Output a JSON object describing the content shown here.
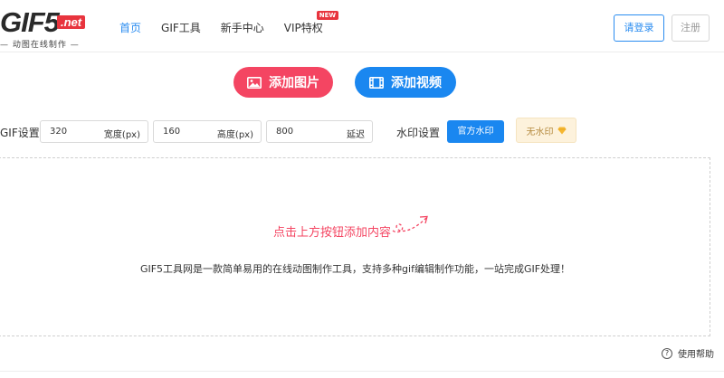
{
  "logo": {
    "main": "GIF5",
    "net": ".net",
    "tagline": "— 动图在线制作 —"
  },
  "nav": {
    "items": [
      {
        "label": "首页",
        "active": true
      },
      {
        "label": "GIF工具",
        "active": false
      },
      {
        "label": "新手中心",
        "active": false
      },
      {
        "label": "VIP特权",
        "active": false,
        "badge": "NEW"
      }
    ]
  },
  "auth": {
    "login_label": "请登录",
    "register_label": "注册"
  },
  "actions": {
    "add_image_label": "添加图片",
    "add_video_label": "添加视频"
  },
  "settings": {
    "label": "GIF设置:",
    "width": {
      "value": "320",
      "unit": "宽度(px)"
    },
    "height": {
      "value": "160",
      "unit": "高度(px)"
    },
    "delay": {
      "value": "800",
      "unit": "延迟"
    },
    "watermark_label": "水印设置",
    "official_watermark_label": "官方水印",
    "no_watermark_label": "无水印"
  },
  "dropzone": {
    "hint": "点击上方按钮添加内容",
    "description": "GIF5工具网是一款简单易用的在线动图制作工具，支持多种gif编辑制作功能，一站完成GIF处理！"
  },
  "help": {
    "label": "使用帮助",
    "icon": "?"
  },
  "colors": {
    "primary": "#1a87f0",
    "accent": "#f44562",
    "nav_active": "#2a8cf0"
  }
}
